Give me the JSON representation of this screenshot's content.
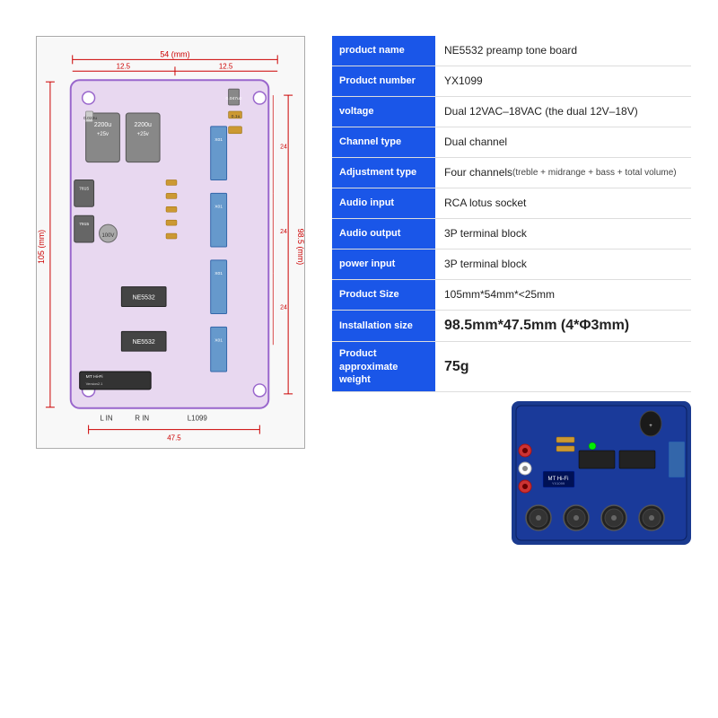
{
  "specs": {
    "rows": [
      {
        "label": "product name",
        "value": "NE5532 preamp tone board",
        "id": "product-name"
      },
      {
        "label": "Product number",
        "value": "YX1099",
        "id": "product-number"
      },
      {
        "label": "voltage",
        "value": "Dual 12VAC–18VAC (the dual 12V–18V)",
        "id": "voltage"
      },
      {
        "label": "Channel type",
        "value": "Dual channel",
        "id": "channel-type"
      },
      {
        "label": "Adjustment type",
        "value": "Four channels",
        "subtext": "(treble + midrange + bass + total volume)",
        "id": "adjustment-type"
      },
      {
        "label": "Audio input",
        "value": "RCA lotus socket",
        "id": "audio-input"
      },
      {
        "label": "Audio output",
        "value": "3P terminal block",
        "id": "audio-output"
      },
      {
        "label": "power input",
        "value": "3P terminal block",
        "id": "power-input"
      },
      {
        "label": "Product Size",
        "value": "105mm*54mm*<25mm",
        "id": "product-size"
      },
      {
        "label": "Installation size",
        "value": "98.5mm*47.5mm (4*Φ3mm)",
        "id": "installation-size",
        "large": true
      },
      {
        "label": "Product approximate weight",
        "value": "75g",
        "id": "product-weight",
        "large": true
      }
    ]
  },
  "diagram": {
    "width_label": "54 (mm)",
    "height_label_outer": "105 (mm)",
    "height_label_inner": "98.5 (mm)",
    "width_label2": "47.5",
    "top_dim": "12.5"
  }
}
